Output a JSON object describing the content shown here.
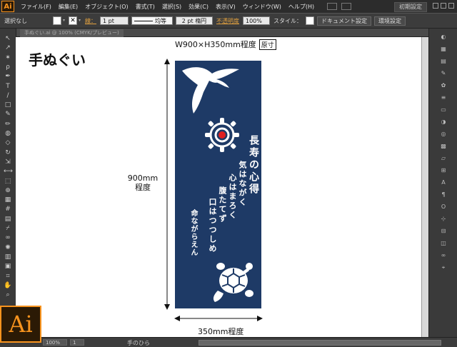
{
  "app": {
    "logo": "Ai",
    "workspace": "初期設定",
    "brand_color": "#f7931e"
  },
  "menu": {
    "items": [
      {
        "label": "ファイル(F)"
      },
      {
        "label": "編集(E)"
      },
      {
        "label": "オブジェクト(O)"
      },
      {
        "label": "書式(T)"
      },
      {
        "label": "選択(S)"
      },
      {
        "label": "効果(C)"
      },
      {
        "label": "表示(V)"
      },
      {
        "label": "ウィンドウ(W)"
      },
      {
        "label": "ヘルプ(H)"
      }
    ]
  },
  "control": {
    "selection_state": "選択なし",
    "stroke_label": "線：",
    "stroke_weight": "1 pt",
    "stroke_profile": "均等",
    "brush": "2 pt 楕円",
    "opacity_label": "不透明度",
    "opacity_value": "100%",
    "style_label": "スタイル：",
    "doc_settings": "ドキュメント設定",
    "preferences": "環境設定"
  },
  "document": {
    "tab_label": "手ぬぐい.ai @ 100% (CMYK/プレビュー)"
  },
  "canvas": {
    "title": "手ぬぐい",
    "dim_top": "W900×H350mm程度",
    "dim_top_box": "原寸",
    "dim_left_line1": "900mm",
    "dim_left_line2": "程度",
    "dim_bottom": "350mm程度",
    "towel_color": "#1e3a66",
    "poem": {
      "title": "長寿の心得",
      "line1": "気はながく",
      "line2": "心はまろく",
      "line3": "腹たてず",
      "line4": "口はつつしめ",
      "line5": "命ながらえん"
    }
  },
  "status": {
    "zoom": "100%",
    "page": "1",
    "tool_name": "手のひら"
  },
  "tools": [
    {
      "icon": "selection-tool-icon",
      "glyph": "↖"
    },
    {
      "icon": "direct-selection-tool-icon",
      "glyph": "↗"
    },
    {
      "icon": "magic-wand-tool-icon",
      "glyph": "✶"
    },
    {
      "icon": "lasso-tool-icon",
      "glyph": "ρ"
    },
    {
      "icon": "pen-tool-icon",
      "glyph": "✒"
    },
    {
      "icon": "type-tool-icon",
      "glyph": "T"
    },
    {
      "icon": "line-tool-icon",
      "glyph": "/"
    },
    {
      "icon": "rectangle-tool-icon",
      "glyph": "□"
    },
    {
      "icon": "paintbrush-tool-icon",
      "glyph": "✎"
    },
    {
      "icon": "pencil-tool-icon",
      "glyph": "✏"
    },
    {
      "icon": "blob-brush-tool-icon",
      "glyph": "◍"
    },
    {
      "icon": "eraser-tool-icon",
      "glyph": "◇"
    },
    {
      "icon": "rotate-tool-icon",
      "glyph": "↻"
    },
    {
      "icon": "scale-tool-icon",
      "glyph": "⇲"
    },
    {
      "icon": "width-tool-icon",
      "glyph": "⟷"
    },
    {
      "icon": "free-transform-tool-icon",
      "glyph": "⬚"
    },
    {
      "icon": "shape-builder-tool-icon",
      "glyph": "⊕"
    },
    {
      "icon": "perspective-grid-tool-icon",
      "glyph": "▦"
    },
    {
      "icon": "mesh-tool-icon",
      "glyph": "#"
    },
    {
      "icon": "gradient-tool-icon",
      "glyph": "▤"
    },
    {
      "icon": "eyedropper-tool-icon",
      "glyph": "⌿"
    },
    {
      "icon": "blend-tool-icon",
      "glyph": "∞"
    },
    {
      "icon": "symbol-sprayer-tool-icon",
      "glyph": "✺"
    },
    {
      "icon": "column-graph-tool-icon",
      "glyph": "▥"
    },
    {
      "icon": "artboard-tool-icon",
      "glyph": "▣"
    },
    {
      "icon": "slice-tool-icon",
      "glyph": "⌗"
    },
    {
      "icon": "hand-tool-icon",
      "glyph": "✋"
    },
    {
      "icon": "zoom-tool-icon",
      "glyph": "⌕"
    }
  ],
  "panels": [
    {
      "icon": "color-panel-icon",
      "glyph": "◐"
    },
    {
      "icon": "color-guide-panel-icon",
      "glyph": "▦"
    },
    {
      "icon": "swatches-panel-icon",
      "glyph": "▤"
    },
    {
      "icon": "brushes-panel-icon",
      "glyph": "✎"
    },
    {
      "icon": "symbols-panel-icon",
      "glyph": "✿"
    },
    {
      "icon": "stroke-panel-icon",
      "glyph": "≡"
    },
    {
      "icon": "gradient-panel-icon",
      "glyph": "▭"
    },
    {
      "icon": "transparency-panel-icon",
      "glyph": "◑"
    },
    {
      "icon": "appearance-panel-icon",
      "glyph": "◎"
    },
    {
      "icon": "graphic-styles-panel-icon",
      "glyph": "▩"
    },
    {
      "icon": "layers-panel-icon",
      "glyph": "▱"
    },
    {
      "icon": "artboards-panel-icon",
      "glyph": "⊞"
    },
    {
      "icon": "character-panel-icon",
      "glyph": "A"
    },
    {
      "icon": "paragraph-panel-icon",
      "glyph": "¶"
    },
    {
      "icon": "opentype-panel-icon",
      "glyph": "O"
    },
    {
      "icon": "transform-panel-icon",
      "glyph": "⊹"
    },
    {
      "icon": "align-panel-icon",
      "glyph": "⊟"
    },
    {
      "icon": "pathfinder-panel-icon",
      "glyph": "◫"
    },
    {
      "icon": "links-panel-icon",
      "glyph": "∞"
    },
    {
      "icon": "navigator-panel-icon",
      "glyph": "⌖"
    }
  ]
}
